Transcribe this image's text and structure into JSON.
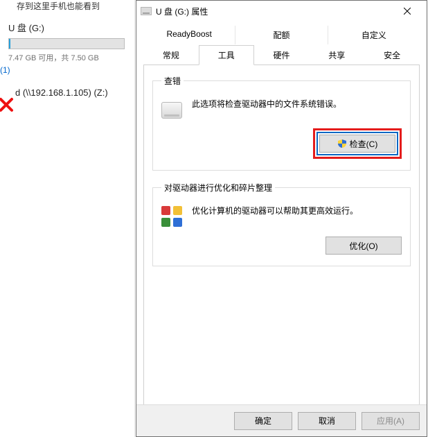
{
  "left": {
    "hint": "存到这里手机也能看到",
    "drive": {
      "name": "U 盘 (G:)",
      "subtext": "7.47 GB 可用，共 7.50 GB"
    },
    "subcount": "(1)",
    "network_drive": "d (\\\\192.168.1.105) (Z:)"
  },
  "dialog": {
    "title": "U 盘 (G:) 属性",
    "tabs_row1": [
      "ReadyBoost",
      "配额",
      "自定义"
    ],
    "tabs_row2": [
      "常规",
      "工具",
      "硬件",
      "共享",
      "安全"
    ],
    "active_tab": "工具",
    "error_check": {
      "legend": "查错",
      "text": "此选项将检查驱动器中的文件系统错误。",
      "button": "检查(C)"
    },
    "optimize": {
      "legend": "对驱动器进行优化和碎片整理",
      "text": "优化计算机的驱动器可以帮助其更高效运行。",
      "button": "优化(O)"
    },
    "footer": {
      "ok": "确定",
      "cancel": "取消",
      "apply": "应用(A)"
    }
  }
}
